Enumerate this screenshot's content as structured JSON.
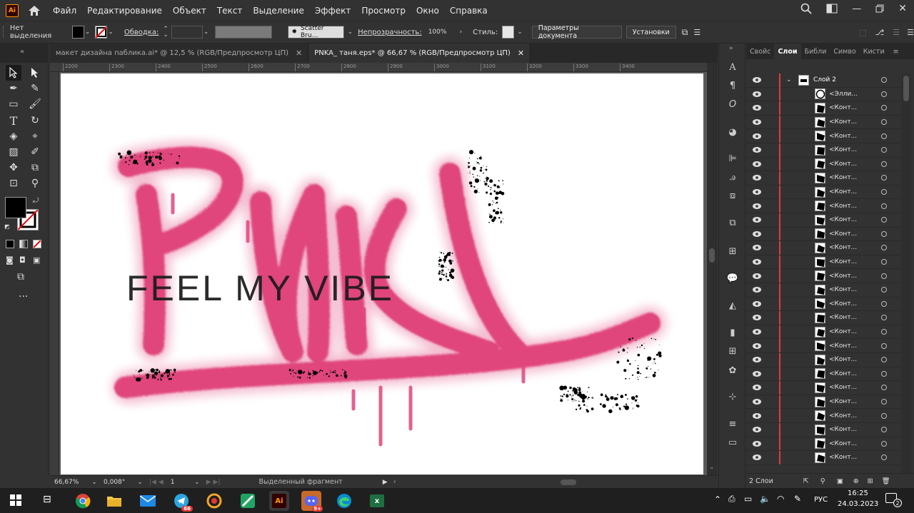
{
  "app": {
    "logo": "Ai",
    "home_icon": "home-icon"
  },
  "menu": [
    "Файл",
    "Редактирование",
    "Объект",
    "Текст",
    "Выделение",
    "Эффект",
    "Просмотр",
    "Окно",
    "Справка"
  ],
  "control_bar": {
    "selection": "Нет выделения",
    "stroke_label": "Обводка:",
    "brush": "Scatter Bru...",
    "opacity_label": "Непрозрачность:",
    "opacity": "100%",
    "style_label": "Стиль:",
    "doc_settings": "Параметры документа",
    "prefs": "Установки"
  },
  "tabs": [
    {
      "label": "макет дизайна паблика.ai* @ 12,5 % (RGB/Предпросмотр ЦП)",
      "close": "✕",
      "active": false
    },
    {
      "label": "PNKA_ таня.eps* @ 66,67 % (RGB/Предпросмотр ЦП)",
      "close": "✕",
      "active": true
    }
  ],
  "ruler_labels": [
    "2200",
    "2300",
    "2400",
    "2500",
    "2600",
    "2700",
    "2800",
    "2900",
    "3000",
    "3100",
    "3200",
    "3300",
    "3400"
  ],
  "artwork": {
    "tag": "PNKA",
    "slogan": "FEEL MY VIBE",
    "pink": "#e0457b",
    "text_color": "#1a1a1a"
  },
  "status_bar": {
    "zoom": "66,67%",
    "rotation": "0,008°",
    "artboard": "1",
    "info": "Выделенный фрагмент"
  },
  "panel_tabs": [
    "Свойс",
    "Слои",
    "Библи",
    "Симво",
    "Кисти"
  ],
  "active_panel_tab": "Слои",
  "layers": {
    "top_layer": "Слой 2",
    "rows": [
      "<Элли...",
      "<Конт...",
      "<Конт...",
      "<Конт...",
      "<Конт...",
      "<Конт...",
      "<Конт...",
      "<Конт...",
      "<Конт...",
      "<Конт...",
      "<Конт...",
      "<Конт...",
      "<Конт...",
      "<Конт...",
      "<Конт...",
      "<Конт...",
      "<Конт...",
      "<Конт...",
      "<Конт...",
      "<Конт...",
      "<Конт...",
      "<Конт...",
      "<Конт...",
      "<Конт...",
      "<Конт...",
      "<Конт...",
      "<Конт..."
    ],
    "footer": "2 Слои"
  },
  "taskbar": {
    "telegram_badge": "66",
    "discord_badge": "9+",
    "lang": "РУС",
    "time": "16:25",
    "date": "24.03.2023",
    "notifications": "2"
  }
}
